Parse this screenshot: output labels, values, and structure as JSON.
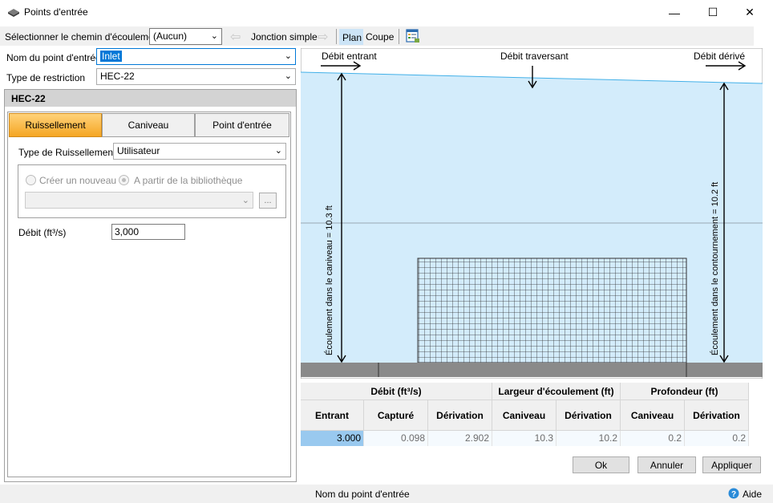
{
  "window": {
    "title": "Points d'entrée",
    "minimize": "—",
    "maximize": "☐",
    "close": "✕"
  },
  "toolbar": {
    "path_label": "Sélectionner le chemin d'écoulement",
    "path_value": "(Aucun)",
    "junction_label": "Jonction simple",
    "plan_label": "Plan",
    "coupe_label": "Coupe"
  },
  "left": {
    "inlet_name_label": "Nom du point d'entrée",
    "inlet_name_value": "Inlet",
    "restriction_label": "Type de restriction",
    "restriction_value": "HEC-22",
    "section_title": "HEC-22",
    "tabs": [
      {
        "label": "Ruissellement",
        "active": true
      },
      {
        "label": "Caniveau",
        "active": false
      },
      {
        "label": "Point d'entrée",
        "active": false
      }
    ],
    "runoff_type_label": "Type de Ruissellement",
    "runoff_type_value": "Utilisateur",
    "radio_new": "Créer un nouveau",
    "radio_library": "A partir de la bibliothèque",
    "library_button": "...",
    "flow_label": "Débit (ft³/s)",
    "flow_value": "3,000"
  },
  "diagram": {
    "inflow_label": "Débit entrant",
    "through_label": "Débit traversant",
    "bypass_label": "Débit dérivé",
    "gutter_spread_label": "Écoulement dans le caniveau = 10.3 ft",
    "bypass_spread_label": "Écoulement dans le contournement = 10.2 ft",
    "colors": {
      "water": "#d3ecfb",
      "grate": "#404040",
      "ground": "#8a8a8a"
    }
  },
  "results": {
    "group_headers": [
      "Débit (ft³/s)",
      "Largeur d'écoulement (ft)",
      "Profondeur (ft)"
    ],
    "columns": [
      "Entrant",
      "Capturé",
      "Dérivation",
      "Caniveau",
      "Dérivation",
      "Caniveau",
      "Dérivation"
    ],
    "row": [
      "3.000",
      "0.098",
      "2.902",
      "10.3",
      "10.2",
      "0.2",
      "0.2"
    ]
  },
  "buttons": {
    "ok": "Ok",
    "cancel": "Annuler",
    "apply": "Appliquer"
  },
  "status": {
    "text": "Nom du point d'entrée",
    "help": "Aide"
  }
}
